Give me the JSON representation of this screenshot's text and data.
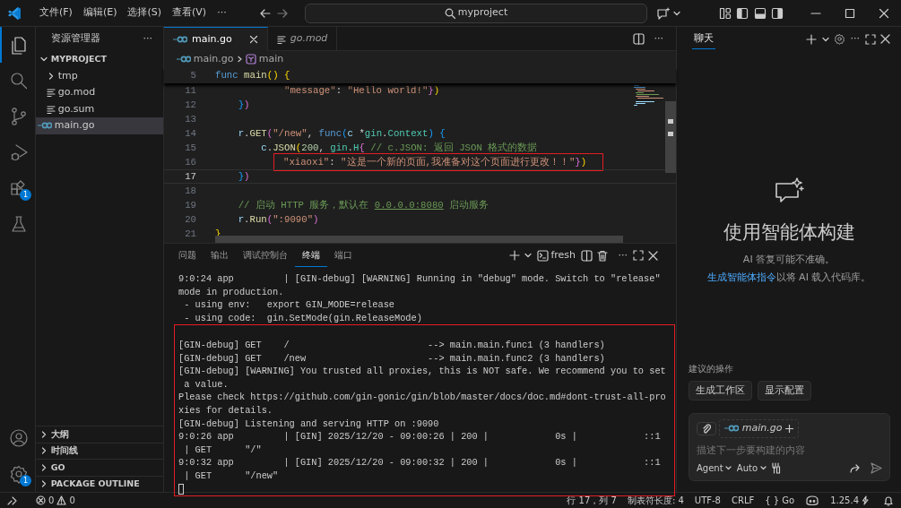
{
  "title_bar": {
    "menus": [
      "文件(F)",
      "编辑(E)",
      "选择(S)",
      "查看(V)",
      "···"
    ],
    "search": {
      "value": "myproject"
    }
  },
  "activity_bar": {
    "items": [
      {
        "kind": "files",
        "selected": true
      },
      {
        "kind": "search",
        "selected": false
      },
      {
        "kind": "source-control",
        "selected": false
      },
      {
        "kind": "run-debug",
        "selected": false
      },
      {
        "kind": "extensions",
        "selected": false,
        "badge": "1"
      },
      {
        "kind": "testing",
        "selected": false
      }
    ],
    "bottom": [
      {
        "kind": "account"
      },
      {
        "kind": "settings",
        "badge": "1"
      }
    ]
  },
  "sidebar": {
    "title": "资源管理器",
    "more": "···",
    "tree": {
      "label": "MYPROJECT",
      "expanded": true,
      "children": [
        {
          "label": "tmp",
          "kind": "folder",
          "expanded": false,
          "selected": false
        },
        {
          "label": "go.mod",
          "kind": "text-file",
          "selected": false
        },
        {
          "label": "go.sum",
          "kind": "text-file",
          "selected": false
        },
        {
          "label": "main.go",
          "kind": "go-file",
          "selected": true
        }
      ]
    },
    "sections": [
      {
        "label": "大纲",
        "expanded": false
      },
      {
        "label": "时间线",
        "expanded": false
      },
      {
        "label": "GO",
        "expanded": false
      },
      {
        "label": "PACKAGE OUTLINE",
        "expanded": false
      }
    ]
  },
  "editor": {
    "tabs": [
      {
        "label": "main.go",
        "kind": "go-file",
        "selected": true,
        "preview": false
      },
      {
        "label": "go.mod",
        "kind": "text-file",
        "selected": false,
        "preview": true
      }
    ],
    "more": "···",
    "breadcrumb": [
      "main.go",
      "main"
    ],
    "sticky_line": {
      "number": "5",
      "tokens": [
        {
          "text": "func",
          "kind": "kw"
        },
        {
          "text": " main",
          "kind": "fn"
        },
        {
          "text": "() {",
          "kind": "b1"
        }
      ]
    },
    "lines": [
      {
        "number": "11",
        "current": false,
        "boxed": false,
        "tokens": [
          {
            "text": "            \"message\"",
            "kind": "str"
          },
          {
            "text": ": ",
            "kind": "plain"
          },
          {
            "text": "\"Hello world!\"",
            "kind": "str"
          },
          {
            "text": "}",
            "kind": "b2"
          },
          {
            "text": ")",
            "kind": "b1"
          }
        ]
      },
      {
        "number": "12",
        "current": false,
        "boxed": false,
        "tokens": [
          {
            "text": "    }",
            "kind": "b3"
          },
          {
            "text": ")",
            "kind": "b2"
          }
        ]
      },
      {
        "number": "13",
        "current": false,
        "boxed": false
      },
      {
        "number": "14",
        "current": false,
        "boxed": false,
        "tokens": [
          {
            "text": "    r",
            "kind": "var"
          },
          {
            "text": ".",
            "kind": "plain"
          },
          {
            "text": "GET",
            "kind": "fn"
          },
          {
            "text": "(",
            "kind": "b2"
          },
          {
            "text": "\"/new\"",
            "kind": "str"
          },
          {
            "text": ", ",
            "kind": "plain"
          },
          {
            "text": "func",
            "kind": "kw"
          },
          {
            "text": "(",
            "kind": "b3"
          },
          {
            "text": "c",
            "kind": "var"
          },
          {
            "text": " *",
            "kind": "plain"
          },
          {
            "text": "gin",
            "kind": "type"
          },
          {
            "text": ".",
            "kind": "plain"
          },
          {
            "text": "Context",
            "kind": "type"
          },
          {
            "text": ") {",
            "kind": "b3"
          }
        ]
      },
      {
        "number": "15",
        "current": false,
        "boxed": false,
        "tokens": [
          {
            "text": "        c",
            "kind": "var"
          },
          {
            "text": ".",
            "kind": "plain"
          },
          {
            "text": "JSON",
            "kind": "fn"
          },
          {
            "text": "(",
            "kind": "b1"
          },
          {
            "text": "200",
            "kind": "num"
          },
          {
            "text": ", ",
            "kind": "plain"
          },
          {
            "text": "gin",
            "kind": "type"
          },
          {
            "text": ".",
            "kind": "plain"
          },
          {
            "text": "H",
            "kind": "type"
          },
          {
            "text": "{",
            "kind": "b2"
          },
          {
            "text": " // c.JSON: 返回 JSON 格式的数据",
            "kind": "cmt"
          }
        ]
      },
      {
        "number": "16",
        "current": false,
        "boxed": true,
        "tokens": [
          {
            "text": "            \"xiaoxi\"",
            "kind": "str"
          },
          {
            "text": ": ",
            "kind": "plain"
          },
          {
            "text": "\"这是一个新的页面,我准备对这个页面进行更改！！\"",
            "kind": "str"
          },
          {
            "text": "}",
            "kind": "b2"
          },
          {
            "text": ")",
            "kind": "b1"
          }
        ]
      },
      {
        "number": "17",
        "current": true,
        "boxed": false,
        "tokens": [
          {
            "text": "    }",
            "kind": "b3"
          },
          {
            "text": ")",
            "kind": "b2"
          }
        ]
      },
      {
        "number": "18",
        "current": false,
        "boxed": false
      },
      {
        "number": "19",
        "current": false,
        "boxed": false,
        "tokens": [
          {
            "text": "    // 启动 HTTP 服务，默认在 ",
            "kind": "cmt"
          },
          {
            "text": "0.0.0.0:8080",
            "kind": "link"
          },
          {
            "text": " 启动服务",
            "kind": "cmt"
          }
        ]
      },
      {
        "number": "20",
        "current": false,
        "boxed": false,
        "tokens": [
          {
            "text": "    r",
            "kind": "var"
          },
          {
            "text": ".",
            "kind": "plain"
          },
          {
            "text": "Run",
            "kind": "fn"
          },
          {
            "text": "(",
            "kind": "b2"
          },
          {
            "text": "\":9090\"",
            "kind": "str"
          },
          {
            "text": ")",
            "kind": "b2"
          }
        ]
      },
      {
        "number": "21",
        "current": false,
        "boxed": false,
        "tokens": [
          {
            "text": "}",
            "kind": "b1"
          }
        ]
      }
    ]
  },
  "panel": {
    "tabs": [
      {
        "label": "问题",
        "selected": false
      },
      {
        "label": "输出",
        "selected": false
      },
      {
        "label": "调试控制台",
        "selected": false
      },
      {
        "label": "终端",
        "selected": true
      },
      {
        "label": "端口",
        "selected": false
      }
    ],
    "terminal_name": "fresh",
    "more": "···",
    "blocks": [
      {
        "boxed": false,
        "lines": [
          "9:0:24 app         | [GIN-debug] [WARNING] Running in \"debug\" mode. Switch to \"release\"",
          "mode in production.",
          " - using env:   export GIN_MODE=release",
          " - using code:  gin.SetMode(gin.ReleaseMode)"
        ]
      },
      {
        "boxed": true,
        "lines": [
          "[GIN-debug] GET    /                         --> main.main.func1 (3 handlers)",
          "[GIN-debug] GET    /new                      --> main.main.func2 (3 handlers)",
          "[GIN-debug] [WARNING] You trusted all proxies, this is NOT safe. We recommend you to set",
          " a value.",
          "Please check https://github.com/gin-gonic/gin/blob/master/docs/doc.md#dont-trust-all-pro",
          "xies for details.",
          "[GIN-debug] Listening and serving HTTP on :9090",
          "9:0:26 app         | [GIN] 2025/12/20 - 09:00:26 | 200 |            0s |            ::1",
          " | GET      \"/\"",
          "9:0:32 app         | [GIN] 2025/12/20 - 09:00:32 | 200 |            0s |            ::1",
          " | GET      \"/new\""
        ]
      }
    ]
  },
  "chat": {
    "tabs": [
      {
        "label": "聊天",
        "selected": true
      }
    ],
    "more": "···",
    "heading": "使用智能体构建",
    "disclaimer": "AI 答复可能不准确。",
    "hint": {
      "link": "生成智能体指令",
      "text": "以将 AI 载入代码库。"
    },
    "suggestions_label": "建议的操作",
    "suggestions": [
      "生成工作区",
      "显示配置"
    ],
    "input": {
      "context_chip": "main.go",
      "placeholder": "描述下一步要构建的内容",
      "mode": "Agent",
      "model": "Auto"
    }
  },
  "status_bar": {
    "errors": "0",
    "warnings": "0",
    "position": "行 17，列 7",
    "indent": "制表符长度: 4",
    "encoding": "UTF-8",
    "eol": "CRLF",
    "language": "{ } Go",
    "version": "1.25.4"
  }
}
